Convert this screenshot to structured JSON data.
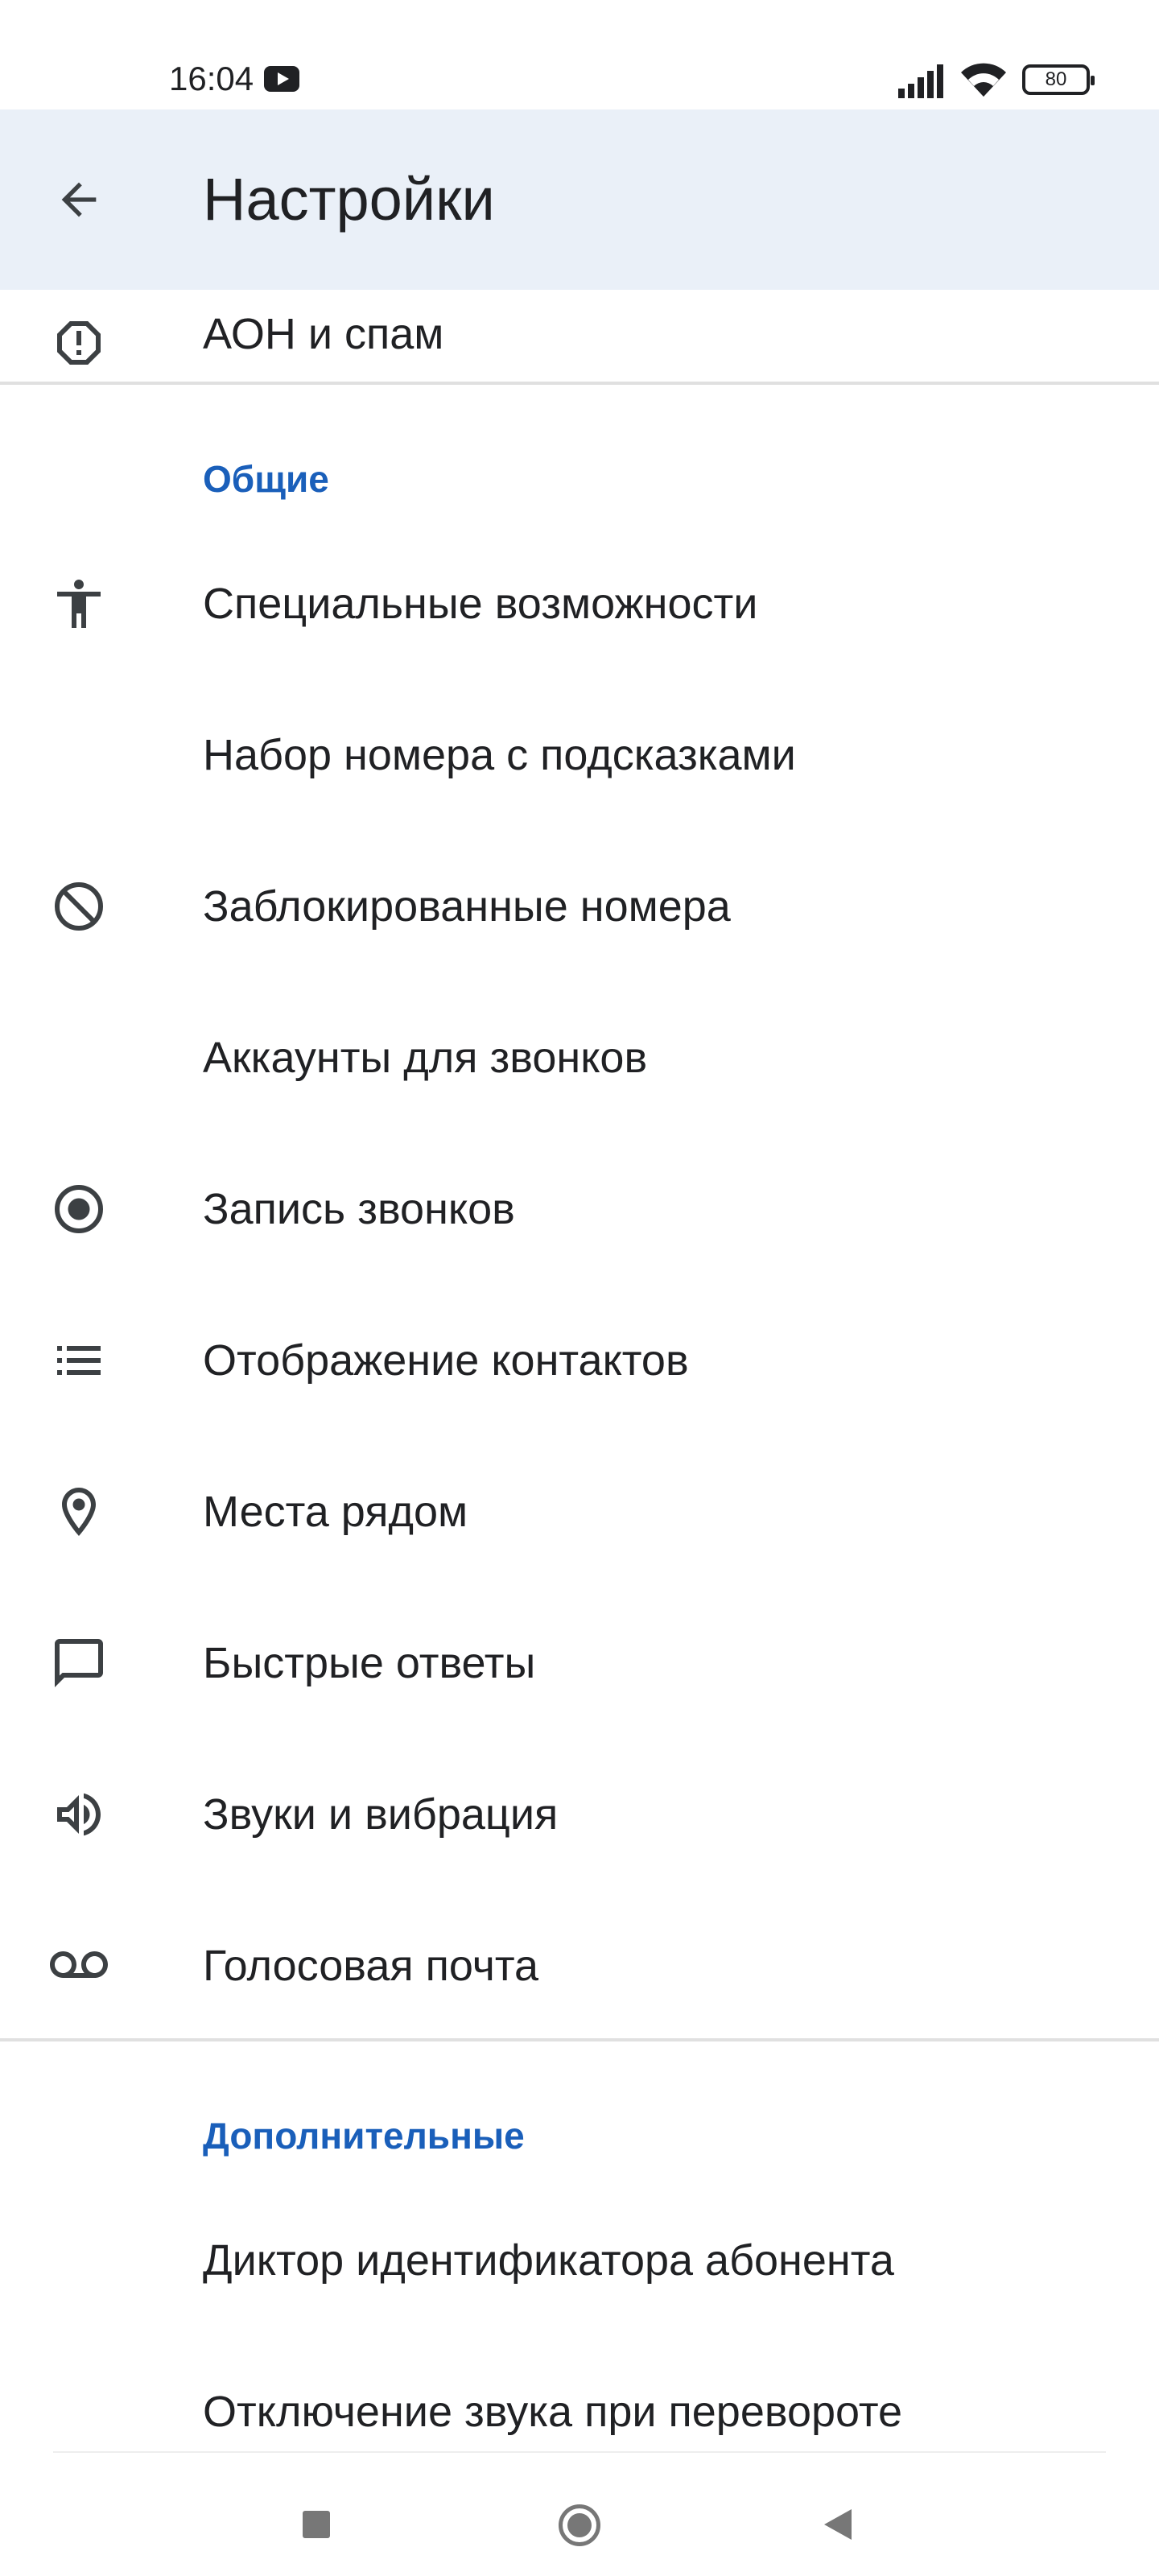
{
  "status_bar": {
    "time": "16:04",
    "battery": "80",
    "youtube_icon": "youtube-icon",
    "signal_icon": "signal-icon",
    "wifi_icon": "wifi-icon"
  },
  "app_bar": {
    "title": "Настройки",
    "back_icon": "arrow-back-icon"
  },
  "items": {
    "caller_id_spam": {
      "label": "АОН и спам",
      "icon": "alert-octagon-icon"
    },
    "accessibility": {
      "label": "Специальные возможности",
      "icon": "accessibility-icon"
    },
    "assisted_dialing": {
      "label": "Набор номера с подсказками"
    },
    "blocked_numbers": {
      "label": "Заблокированные номера",
      "icon": "block-icon"
    },
    "calling_accounts": {
      "label": "Аккаунты для звонков"
    },
    "call_recording": {
      "label": "Запись звонков",
      "icon": "record-icon"
    },
    "contact_display": {
      "label": "Отображение контактов",
      "icon": "list-icon"
    },
    "nearby_places": {
      "label": "Места рядом",
      "icon": "location-pin-icon"
    },
    "quick_responses": {
      "label": "Быстрые ответы",
      "icon": "message-icon"
    },
    "sounds_vibration": {
      "label": "Звуки и вибрация",
      "icon": "volume-icon"
    },
    "voicemail": {
      "label": "Голосовая почта",
      "icon": "voicemail-icon"
    },
    "caller_id_announcement": {
      "label": "Диктор идентификатора абонента"
    },
    "flip_to_silence": {
      "label": "Отключение звука при перевороте"
    }
  },
  "sections": {
    "general": "Общие",
    "advanced": "Дополнительные"
  },
  "colors": {
    "app_bar_bg": "#eaf0f8",
    "accent": "#1a5fba",
    "text": "#202124",
    "icon": "#3c4043"
  }
}
